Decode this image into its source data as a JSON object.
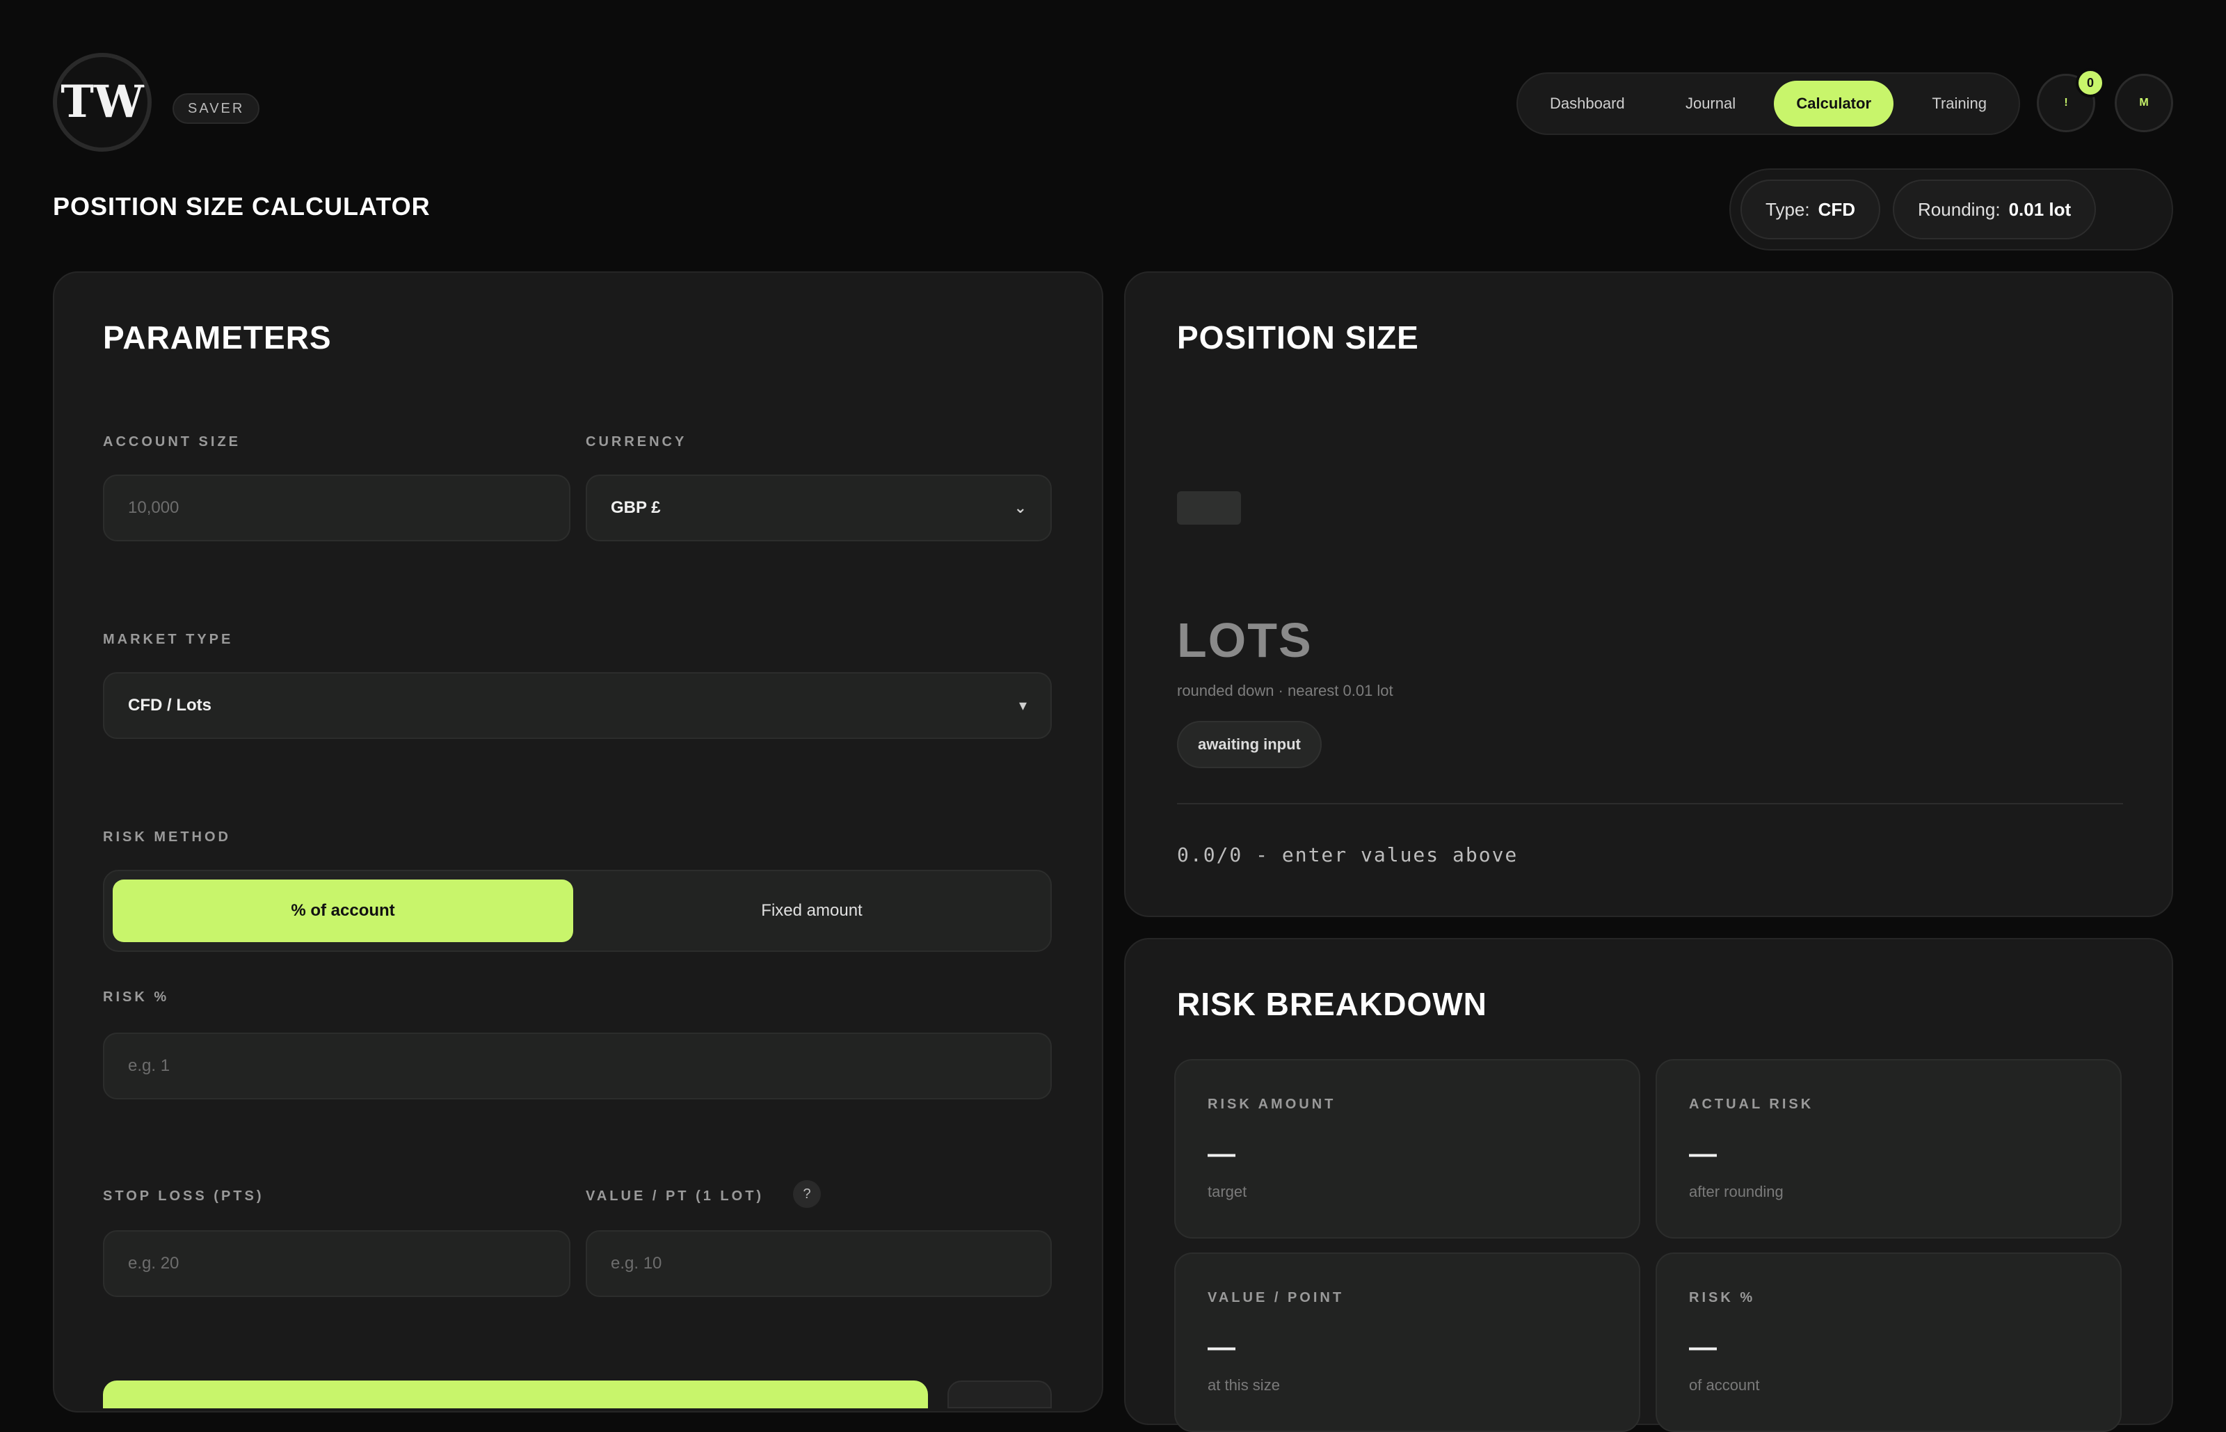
{
  "header": {
    "logo_text": "TW",
    "badge": "SAVER",
    "nav": [
      "Dashboard",
      "Journal",
      "Calculator",
      "Training"
    ],
    "active_nav": "Calculator",
    "profile_icon_letter": "!",
    "notification_count": "0",
    "avatar_letter": "M"
  },
  "page": {
    "title": "POSITION SIZE CALCULATOR",
    "type_label": "Type:",
    "type_value": "CFD",
    "rounding_label": "Rounding:",
    "rounding_value": "0.01 lot"
  },
  "parameters": {
    "title": "PARAMETERS",
    "account_size_label": "ACCOUNT SIZE",
    "account_size_placeholder": "10,000",
    "currency_label": "CURRENCY",
    "currency_value": "GBP £",
    "market_type_label": "MARKET TYPE",
    "market_type_value": "CFD / Lots",
    "risk_method_label": "RISK METHOD",
    "risk_method_options": [
      "% of account",
      "Fixed amount"
    ],
    "risk_method_active": "% of account",
    "risk_pct_label": "RISK %",
    "risk_pct_placeholder": "e.g. 1",
    "stop_loss_label": "STOP LOSS (PTS)",
    "stop_loss_placeholder": "e.g. 20",
    "value_pt_label": "VALUE / PT (1 LOT)",
    "value_pt_placeholder": "e.g. 10",
    "info_icon": "?"
  },
  "position_size": {
    "title": "POSITION SIZE",
    "unit": "LOTS",
    "rounding_note": "rounded down · nearest 0.01 lot",
    "status_badge": "awaiting input",
    "status_text": "0.0/0 - enter values above"
  },
  "risk_breakdown": {
    "title": "RISK BREAKDOWN",
    "stats": [
      {
        "label": "RISK AMOUNT",
        "value": "—",
        "sub": "target"
      },
      {
        "label": "ACTUAL RISK",
        "value": "—",
        "sub": "after rounding"
      },
      {
        "label": "VALUE / POINT",
        "value": "—",
        "sub": "at this size"
      },
      {
        "label": "RISK %",
        "value": "—",
        "sub": "of account"
      }
    ]
  },
  "colors": {
    "accent": "#c8f56b",
    "background": "#0b0b0b",
    "card": "#1a1a1a"
  }
}
